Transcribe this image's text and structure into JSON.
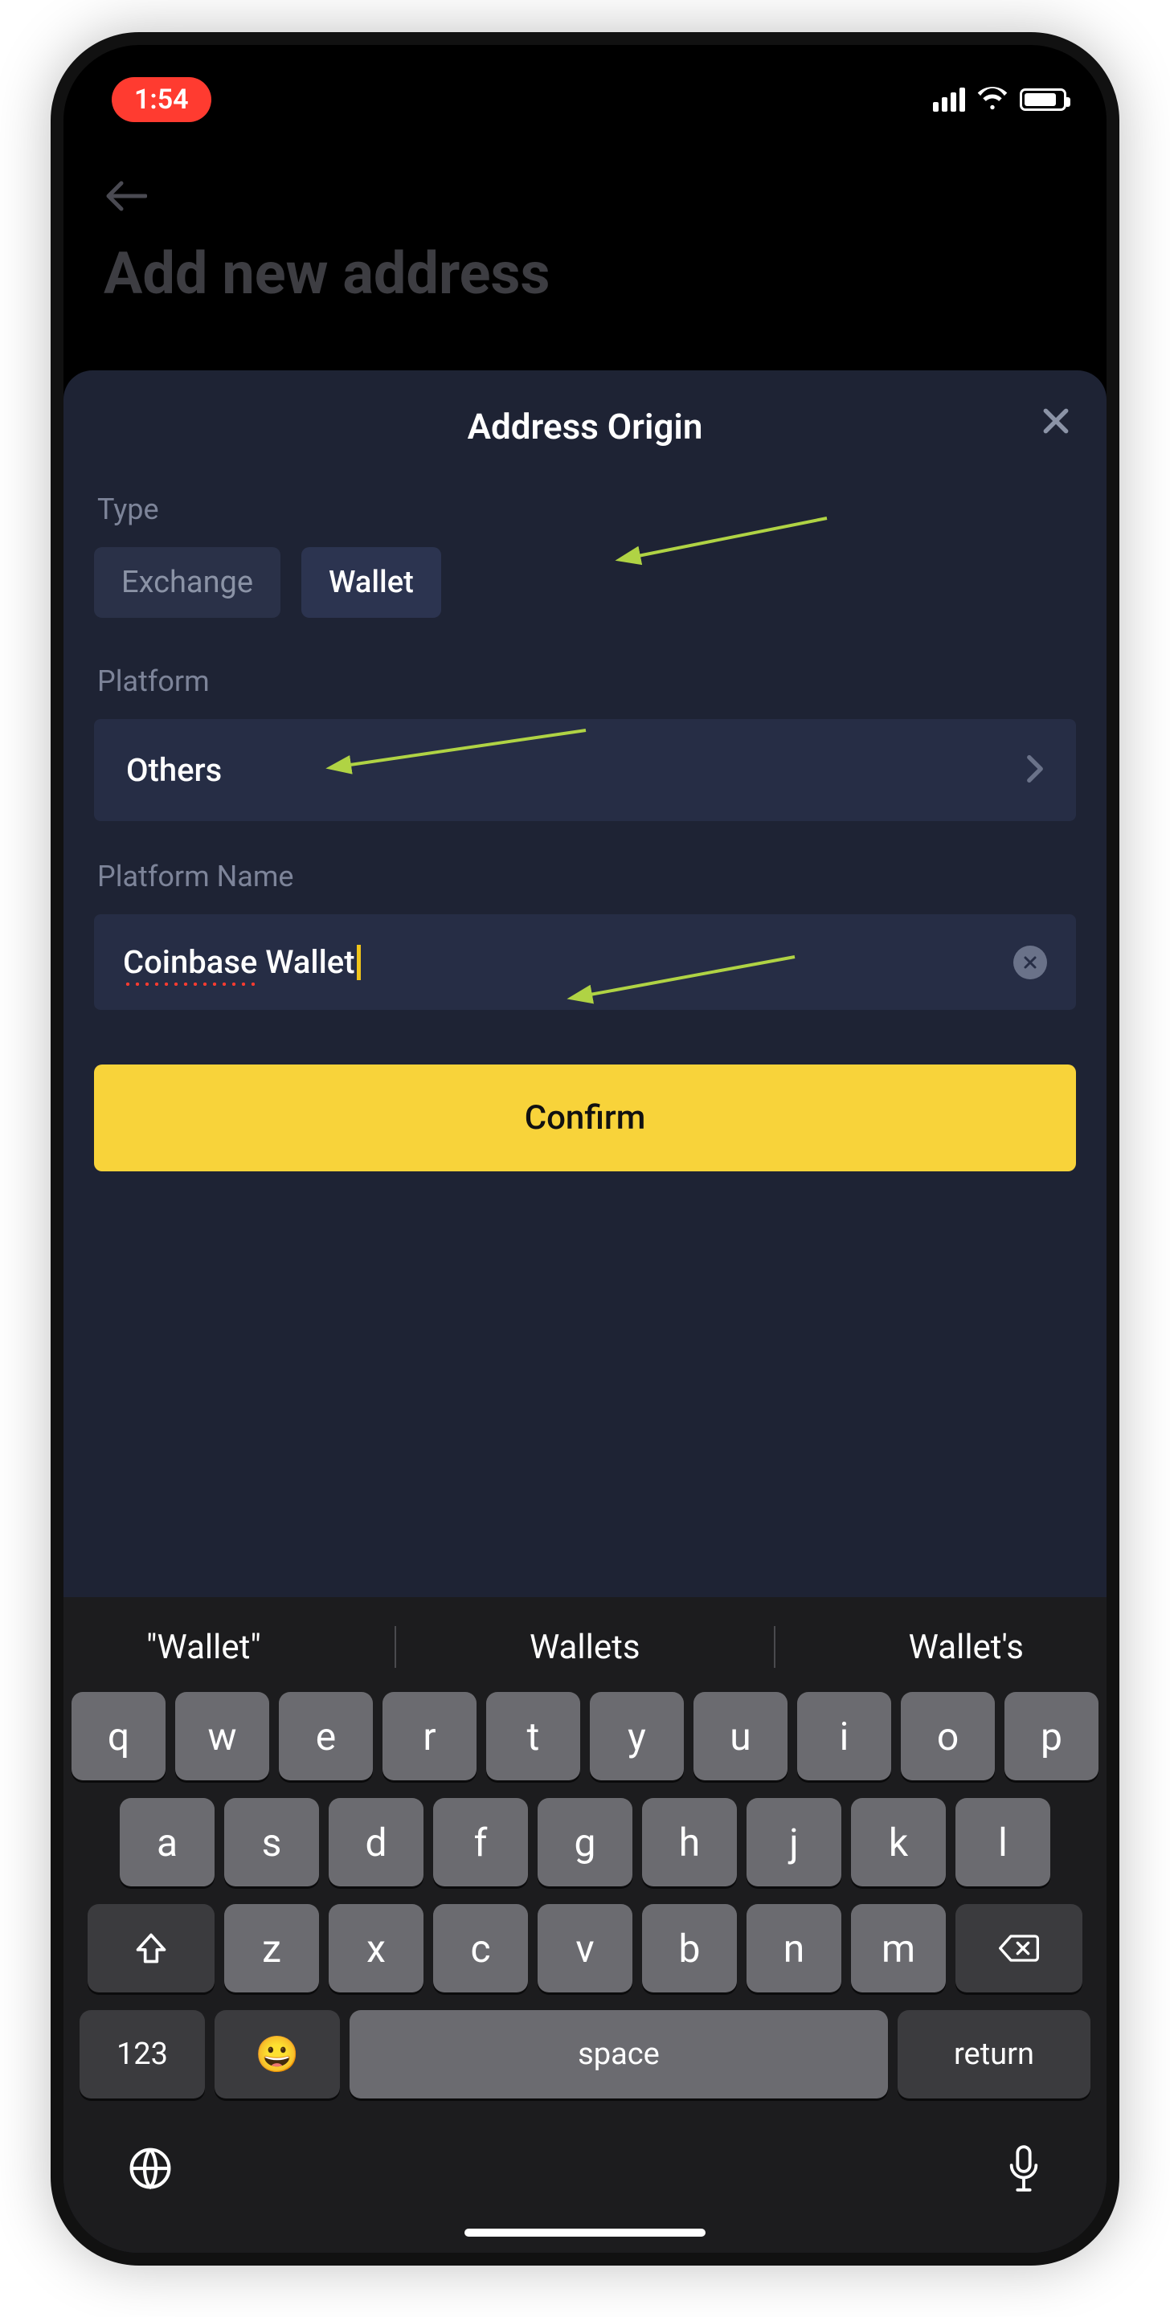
{
  "status": {
    "time": "1:54"
  },
  "page": {
    "title_bg": "Add new address"
  },
  "sheet": {
    "title": "Address Origin",
    "type_label": "Type",
    "type_options": [
      "Exchange",
      "Wallet"
    ],
    "platform_label": "Platform",
    "platform_value": "Others",
    "platform_name_label": "Platform Name",
    "platform_name_value": "Coinbase Wallet",
    "confirm_label": "Confirm"
  },
  "keyboard": {
    "suggestions": [
      "\"Wallet\"",
      "Wallets",
      "Wallet's"
    ],
    "row1": [
      "q",
      "w",
      "e",
      "r",
      "t",
      "y",
      "u",
      "i",
      "o",
      "p"
    ],
    "row2": [
      "a",
      "s",
      "d",
      "f",
      "g",
      "h",
      "j",
      "k",
      "l"
    ],
    "row3": [
      "z",
      "x",
      "c",
      "v",
      "b",
      "n",
      "m"
    ],
    "num_label": "123",
    "space_label": "space",
    "return_label": "return"
  }
}
